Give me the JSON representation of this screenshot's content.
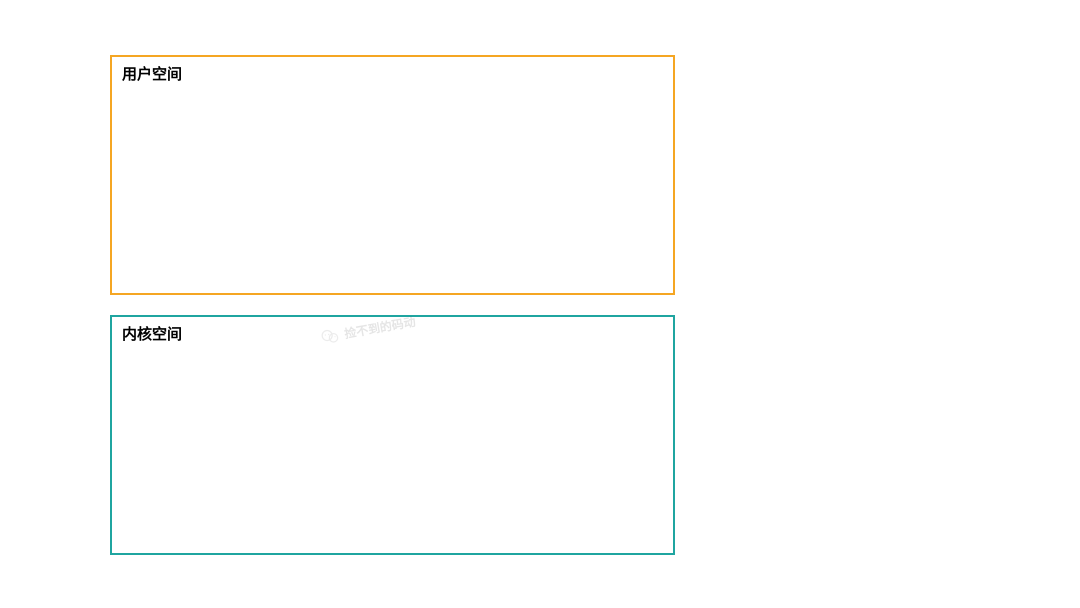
{
  "userSpace": {
    "label": "用户空间",
    "borderColor": "#f5a623"
  },
  "kernelSpace": {
    "label": "内核空间",
    "borderColor": "#1fa5a0"
  },
  "watermark": {
    "text": "捡不到的码动"
  }
}
